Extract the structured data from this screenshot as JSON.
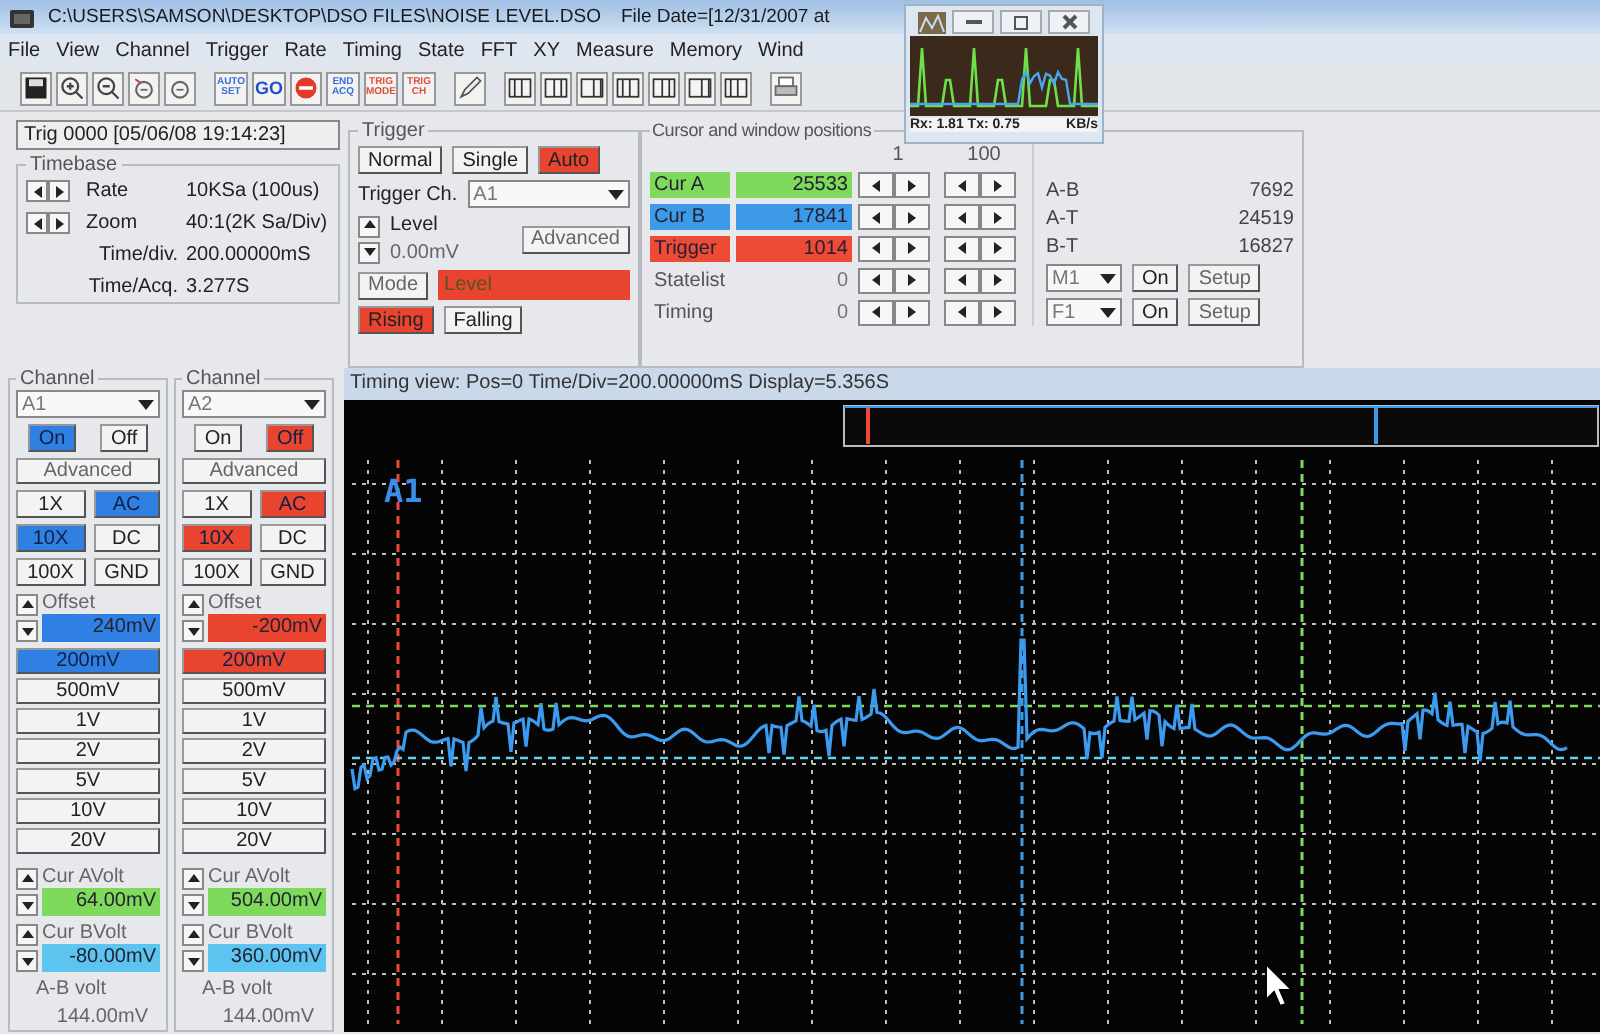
{
  "window": {
    "title": "C:\\USERS\\SAMSON\\DESKTOP\\DSO FILES\\NOISE LEVEL.DSO",
    "file_date": "File Date=[12/31/2007 at"
  },
  "menu": [
    "File",
    "View",
    "Channel",
    "Trigger",
    "Rate",
    "Timing",
    "State",
    "FFT",
    "XY",
    "Measure",
    "Memory",
    "Wind"
  ],
  "toolbar": [
    {
      "label": "AUTO SET",
      "color": "#3b6fd8"
    },
    {
      "label": "GO",
      "color": "#1f4fd0"
    },
    {
      "label": "END ACQ",
      "color": "#3b6fd8"
    },
    {
      "label": "TRIG MODE",
      "color": "#e0503a"
    },
    {
      "label": "TRIG CH",
      "color": "#e0503a"
    }
  ],
  "net_monitor": {
    "rate": "Rx: 1.81 Tx: 0.75",
    "unit": "KB/s"
  },
  "status": "Trig 0000 [05/06/08 19:14:23]",
  "timebase": {
    "title": "Timebase",
    "rows": [
      {
        "kind": "stepper",
        "label": "Rate",
        "value": "10KSa (100us)"
      },
      {
        "kind": "stepper",
        "label": "Zoom",
        "value": "40:1(2K Sa/Div)"
      },
      {
        "kind": "plain",
        "label": "Time/div.",
        "value": "200.00000mS"
      },
      {
        "kind": "plain",
        "label": "Time/Acq.",
        "value": "3.277S"
      }
    ]
  },
  "trigger": {
    "title": "Trigger",
    "modes": [
      {
        "label": "Normal",
        "selected": false
      },
      {
        "label": "Single",
        "selected": false
      },
      {
        "label": "Auto",
        "selected": true
      }
    ],
    "channel_label": "Trigger Ch.",
    "channel": "A1",
    "level_label": "Level",
    "level_value": "0.00mV",
    "advanced": "Advanced",
    "mode_button": "Mode",
    "mode_value": "Level",
    "edges": [
      {
        "label": "Rising",
        "selected": true
      },
      {
        "label": "Falling",
        "selected": false
      }
    ]
  },
  "cursors": {
    "title": "Cursor and window positions",
    "step_headers": [
      "1",
      "100"
    ],
    "rows": [
      {
        "label": "Cur A",
        "value": "25533",
        "color": "#7fd95a"
      },
      {
        "label": "Cur B",
        "value": "17841",
        "color": "#3d9ae8"
      },
      {
        "label": "Trigger",
        "value": "1014",
        "color": "#ee4a36"
      },
      {
        "label": "Statelist",
        "value": "0"
      },
      {
        "label": "Timing",
        "value": "0"
      }
    ],
    "diffs": [
      {
        "label": "A-B",
        "value": "7692"
      },
      {
        "label": "A-T",
        "value": "24519"
      },
      {
        "label": "B-T",
        "value": "16827"
      }
    ],
    "math": [
      {
        "select": "M1",
        "on": "On",
        "setup": "Setup"
      },
      {
        "select": "F1",
        "on": "On",
        "setup": "Setup"
      }
    ]
  },
  "channels": [
    {
      "title": "Channel",
      "select": "A1",
      "color": "#2f80e2",
      "power": [
        {
          "label": "On",
          "selected": true
        },
        {
          "label": "Off",
          "selected": false
        }
      ],
      "advanced": "Advanced",
      "probe": [
        {
          "label": "1X",
          "selected": false
        },
        {
          "label": "10X",
          "selected": true
        },
        {
          "label": "100X",
          "selected": false
        }
      ],
      "coupling": [
        {
          "label": "AC",
          "selected": true
        },
        {
          "label": "DC",
          "selected": false
        },
        {
          "label": "GND",
          "selected": false
        }
      ],
      "offset_label": "Offset",
      "offset": "240mV",
      "volts": [
        {
          "label": "200mV",
          "selected": true
        },
        {
          "label": "500mV",
          "selected": false
        },
        {
          "label": "1V",
          "selected": false
        },
        {
          "label": "2V",
          "selected": false
        },
        {
          "label": "5V",
          "selected": false
        },
        {
          "label": "10V",
          "selected": false
        },
        {
          "label": "20V",
          "selected": false
        }
      ],
      "cur_a_label": "Cur AVolt",
      "cur_a": "64.00mV",
      "cur_b_label": "Cur BVolt",
      "cur_b": "-80.00mV",
      "diff_label": "A-B volt",
      "diff": "144.00mV"
    },
    {
      "title": "Channel",
      "select": "A2",
      "color": "#e8442f",
      "power": [
        {
          "label": "On",
          "selected": false
        },
        {
          "label": "Off",
          "selected": true
        }
      ],
      "advanced": "Advanced",
      "probe": [
        {
          "label": "1X",
          "selected": false
        },
        {
          "label": "10X",
          "selected": true
        },
        {
          "label": "100X",
          "selected": false
        }
      ],
      "coupling": [
        {
          "label": "AC",
          "selected": true
        },
        {
          "label": "DC",
          "selected": false
        },
        {
          "label": "GND",
          "selected": false
        }
      ],
      "offset_label": "Offset",
      "offset": "-200mV",
      "volts": [
        {
          "label": "200mV",
          "selected": true
        },
        {
          "label": "500mV",
          "selected": false
        },
        {
          "label": "1V",
          "selected": false
        },
        {
          "label": "2V",
          "selected": false
        },
        {
          "label": "5V",
          "selected": false
        },
        {
          "label": "10V",
          "selected": false
        },
        {
          "label": "20V",
          "selected": false
        }
      ],
      "cur_a_label": "Cur AVolt",
      "cur_a": "504.00mV",
      "cur_b_label": "Cur BVolt",
      "cur_b": "360.00mV",
      "diff_label": "A-B volt",
      "diff": "144.00mV"
    }
  ],
  "timing_view": {
    "title": "Timing view: Pos=0 Time/Div=200.00000mS Display=5.356S",
    "trace_label": "A1"
  }
}
